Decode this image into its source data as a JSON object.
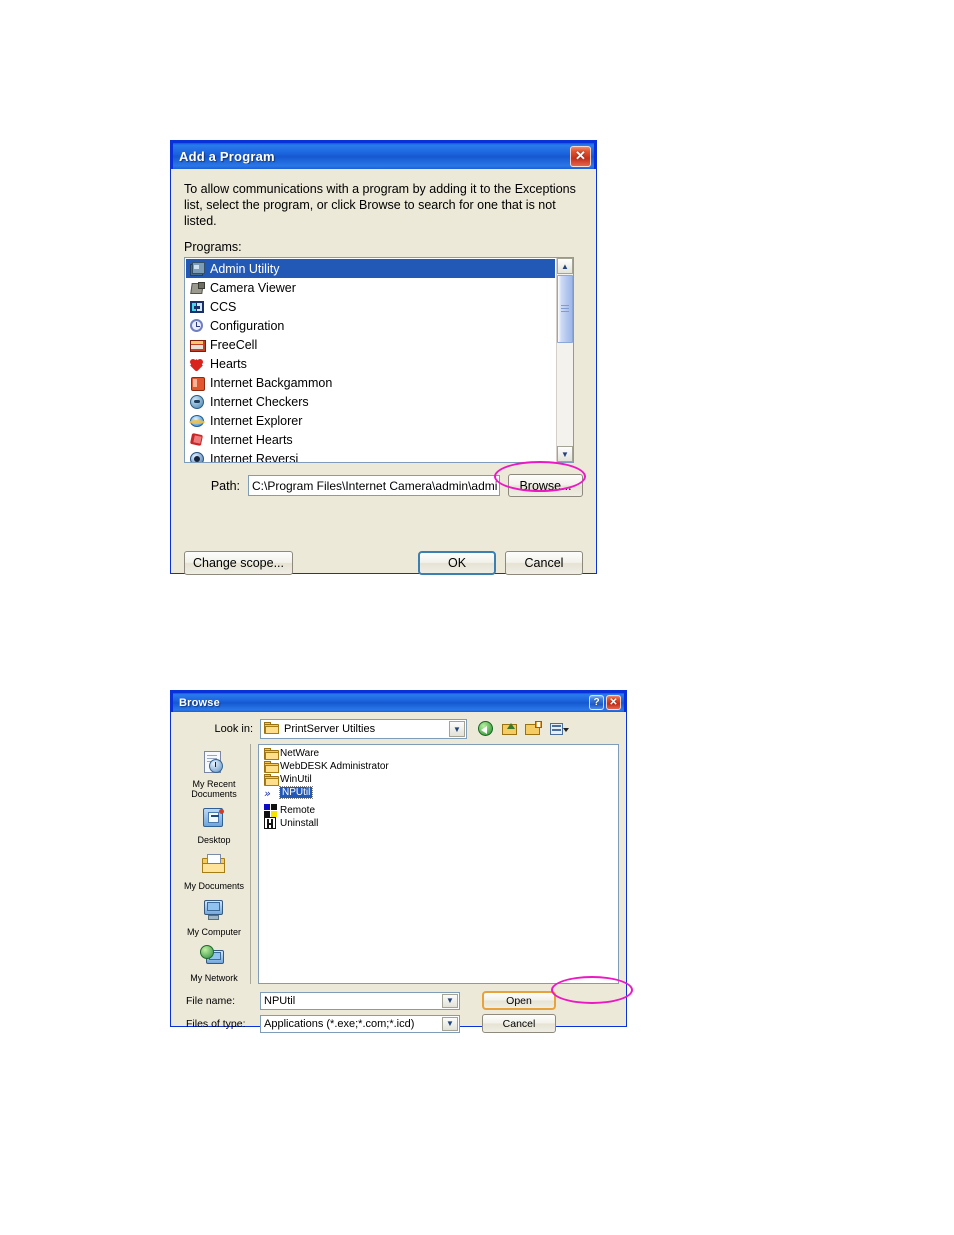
{
  "dialog1": {
    "title": "Add a Program",
    "close_label": "✕",
    "description": "To allow communications with a program by adding it to the Exceptions list, select the program, or click Browse to search for one that is not listed.",
    "programs_label": "Programs:",
    "programs": [
      {
        "label": "Admin Utility",
        "icon": "admin-utility-icon",
        "selected": true
      },
      {
        "label": "Camera Viewer",
        "icon": "camera-viewer-icon",
        "selected": false
      },
      {
        "label": "CCS",
        "icon": "ccs-icon",
        "selected": false
      },
      {
        "label": "Configuration",
        "icon": "configuration-icon",
        "selected": false
      },
      {
        "label": "FreeCell",
        "icon": "freecell-icon",
        "selected": false
      },
      {
        "label": "Hearts",
        "icon": "hearts-icon",
        "selected": false
      },
      {
        "label": "Internet Backgammon",
        "icon": "internet-backgammon-icon",
        "selected": false
      },
      {
        "label": "Internet Checkers",
        "icon": "internet-checkers-icon",
        "selected": false
      },
      {
        "label": "Internet Explorer",
        "icon": "internet-explorer-icon",
        "selected": false
      },
      {
        "label": "Internet Hearts",
        "icon": "internet-hearts-icon",
        "selected": false
      },
      {
        "label": "Internet Reversi",
        "icon": "internet-reversi-icon",
        "selected": false
      }
    ],
    "path_label": "Path:",
    "path_value": "C:\\Program Files\\Internet Camera\\admin\\admi",
    "browse_label": "Browse...",
    "change_scope_label": "Change scope...",
    "ok_label": "OK",
    "cancel_label": "Cancel"
  },
  "dialog2": {
    "title": "Browse",
    "help_label": "?",
    "close_label": "✕",
    "look_in_label": "Look in:",
    "look_in_value": "PrintServer Utilties",
    "toolbar": [
      {
        "name": "back-icon",
        "tooltip": "Back"
      },
      {
        "name": "up-one-level-icon",
        "tooltip": "Up One Level"
      },
      {
        "name": "create-new-folder-icon",
        "tooltip": "Create New Folder"
      },
      {
        "name": "views-icon",
        "tooltip": "Views"
      }
    ],
    "places": [
      {
        "label": "My Recent\nDocuments",
        "icon": "my-recent-documents-icon"
      },
      {
        "label": "Desktop",
        "icon": "desktop-icon"
      },
      {
        "label": "My Documents",
        "icon": "my-documents-icon"
      },
      {
        "label": "My Computer",
        "icon": "my-computer-icon"
      },
      {
        "label": "My Network",
        "icon": "my-network-icon"
      }
    ],
    "files": [
      {
        "label": "NetWare",
        "icon": "folder-icon",
        "selected": false
      },
      {
        "label": "WebDESK Administrator",
        "icon": "folder-icon",
        "selected": false
      },
      {
        "label": "WinUtil",
        "icon": "folder-icon",
        "selected": false
      },
      {
        "label": "NPUtil",
        "icon": "nputil-icon",
        "selected": true
      },
      {
        "label": "Remote",
        "icon": "remote-icon",
        "selected": false
      },
      {
        "label": "Uninstall",
        "icon": "uninstall-icon",
        "selected": false
      }
    ],
    "file_name_label": "File name:",
    "file_name_value": "NPUtil",
    "files_of_type_label": "Files of type:",
    "files_of_type_value": "Applications (*.exe;*.com;*.icd)",
    "open_label": "Open",
    "cancel_label": "Cancel"
  },
  "annotations": {
    "color": "#ec18c4",
    "items": [
      {
        "name": "browse-button-highlight",
        "target": "browse-button"
      },
      {
        "name": "open-button-highlight",
        "target": "open-button"
      }
    ]
  }
}
